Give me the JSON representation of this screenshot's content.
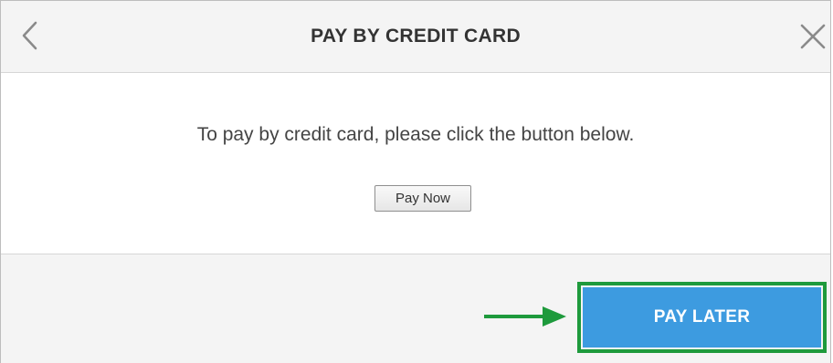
{
  "dialog": {
    "title": "PAY BY CREDIT CARD",
    "back_icon": "chevron-left-icon",
    "close_icon": "close-icon"
  },
  "body": {
    "message": "To pay by credit card, please click the button below.",
    "pay_now_label": "Pay Now"
  },
  "footer": {
    "pay_later_label": "PAY LATER",
    "highlight_icon": "arrow-right-icon"
  },
  "colors": {
    "header_bg": "#f4f4f4",
    "primary_button": "#3d9be0",
    "highlight": "#1e9a3c",
    "title_text": "#333333"
  }
}
